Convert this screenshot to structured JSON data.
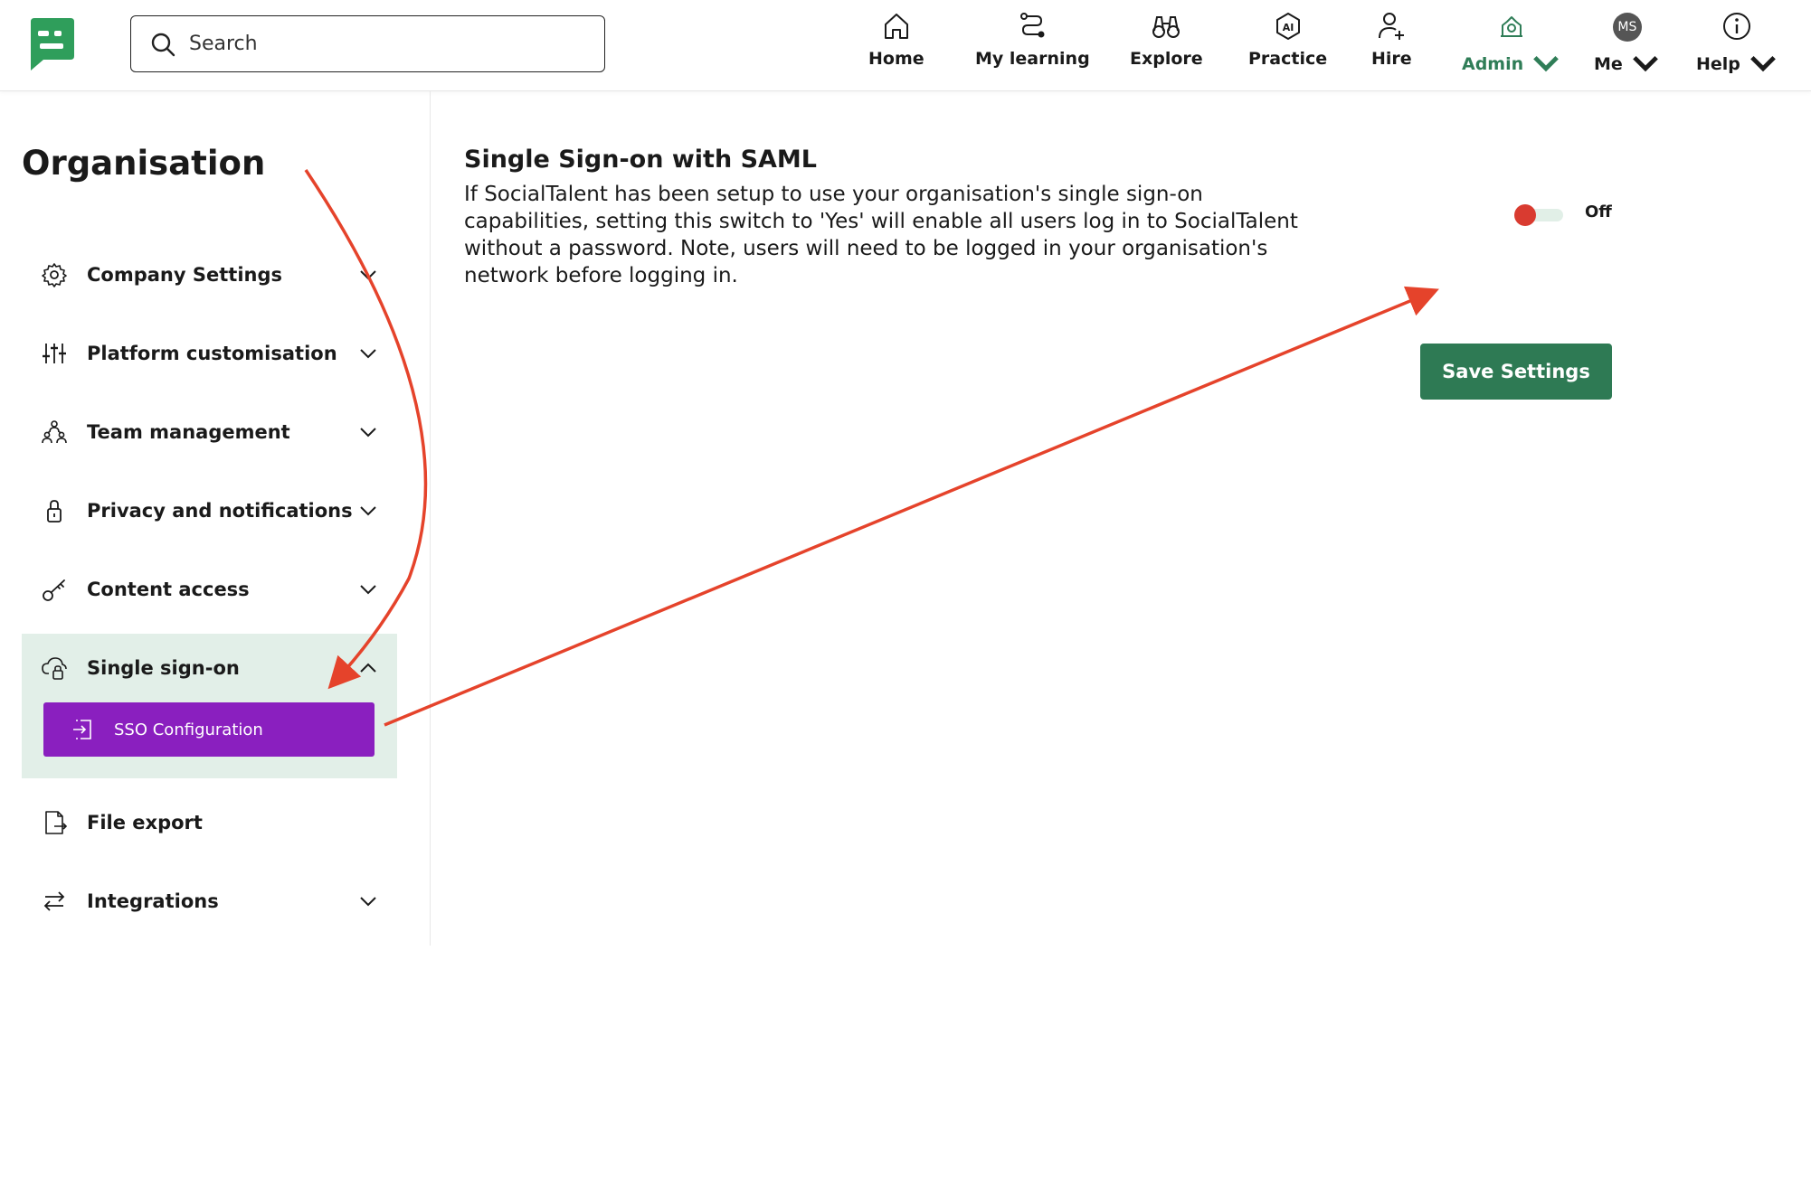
{
  "header": {
    "search": {
      "placeholder": "Search",
      "value": ""
    },
    "nav": [
      {
        "key": "home",
        "label": "Home",
        "icon": "home-icon"
      },
      {
        "key": "my-learning",
        "label": "My learning",
        "icon": "learning-path-icon"
      },
      {
        "key": "explore",
        "label": "Explore",
        "icon": "binoculars-icon"
      },
      {
        "key": "practice",
        "label": "Practice",
        "icon": "ai-badge-icon",
        "badge_text": "AI"
      },
      {
        "key": "hire",
        "label": "Hire",
        "icon": "add-user-icon"
      },
      {
        "key": "admin",
        "label": "Admin",
        "icon": "admin-icon",
        "active": true,
        "has_dropdown": true
      },
      {
        "key": "me",
        "label": "Me",
        "icon": "avatar",
        "avatar_initials": "MS",
        "has_dropdown": true
      },
      {
        "key": "help",
        "label": "Help",
        "icon": "info-icon",
        "has_dropdown": true
      }
    ]
  },
  "sidebar": {
    "title": "Organisation",
    "items": [
      {
        "label": "Company Settings",
        "icon": "gear-icon",
        "chevron": "down"
      },
      {
        "label": "Platform customisation",
        "icon": "sliders-icon",
        "chevron": "down"
      },
      {
        "label": "Team management",
        "icon": "team-icon",
        "chevron": "down"
      },
      {
        "label": "Privacy and notifications",
        "icon": "lock-icon",
        "chevron": "down"
      },
      {
        "label": "Content access",
        "icon": "key-icon",
        "chevron": "down"
      },
      {
        "label": "Single sign-on",
        "icon": "cloud-lock-icon",
        "chevron": "up",
        "expanded": true,
        "children": [
          {
            "label": "SSO Configuration",
            "icon": "sign-in-icon",
            "selected": true
          }
        ]
      },
      {
        "label": "File export",
        "icon": "file-export-icon"
      },
      {
        "label": "Integrations",
        "icon": "swap-arrows-icon",
        "chevron": "down"
      }
    ]
  },
  "main": {
    "title": "Single Sign-on with SAML",
    "description": "If SocialTalent has been setup to use your organisation's single sign-on capabilities, setting this switch to 'Yes' will enable all users log in to SocialTalent without a password. Note, users will need to be logged in your organisation's network before logging in.",
    "toggle": {
      "state": "Off",
      "on": false
    },
    "save_button": "Save Settings"
  },
  "colors": {
    "brand_green": "#2e7a54",
    "active_nav": "#2f7d57",
    "selected_sub_item": "#8a1fbf",
    "expanded_group_bg": "#e2efe8",
    "toggle_knob_off": "#d93b30",
    "annotation_arrow": "#e5432b"
  }
}
